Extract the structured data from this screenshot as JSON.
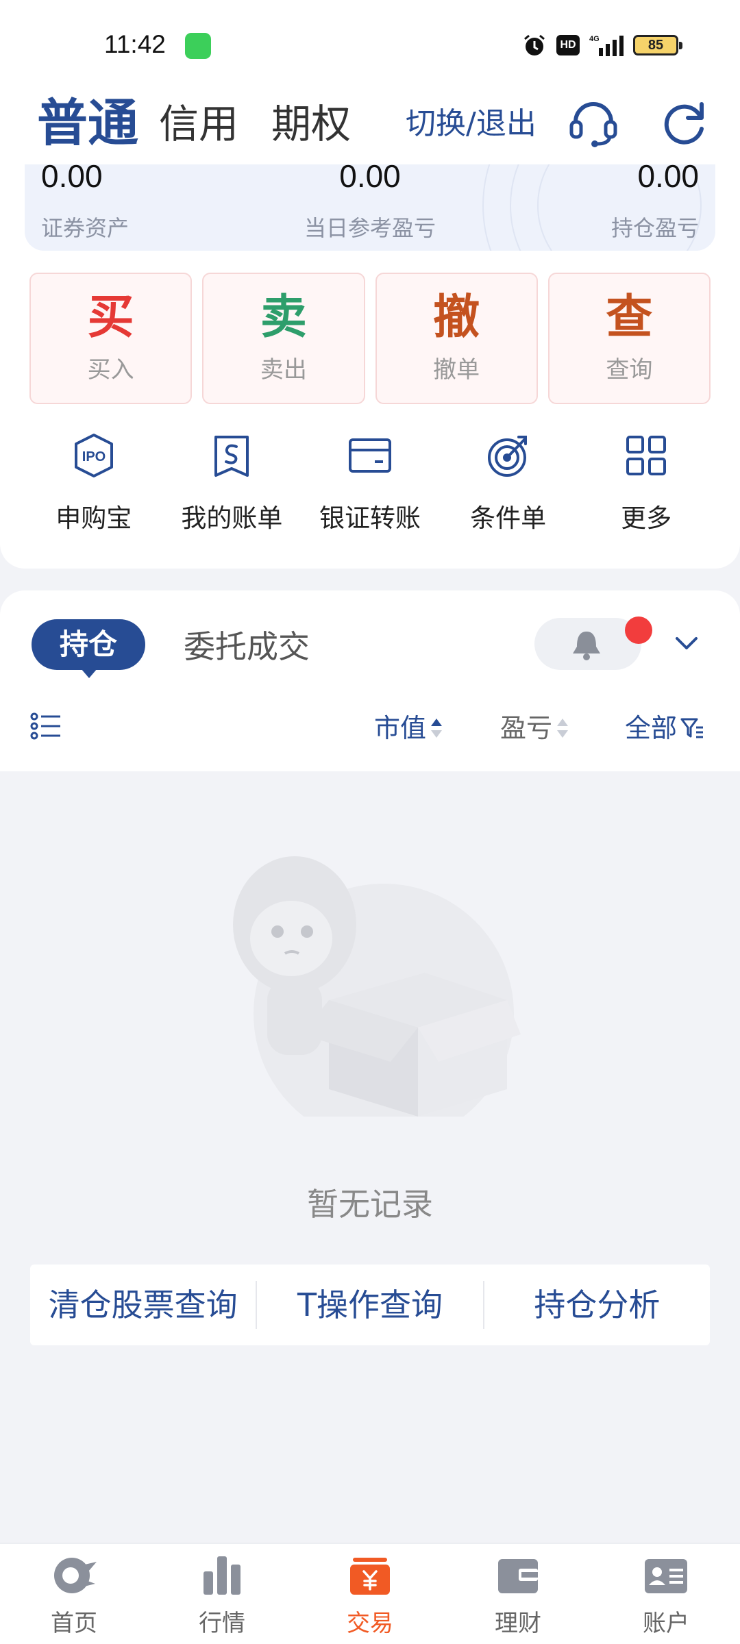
{
  "status_bar": {
    "time": "11:42",
    "battery": "85",
    "network": "4G",
    "hd": "HD"
  },
  "header": {
    "tabs": [
      "普通",
      "信用",
      "期权"
    ],
    "switch_exit": "切换/退出"
  },
  "assets": [
    {
      "value": "0.00",
      "label": "证券资产"
    },
    {
      "value": "0.00",
      "label": "当日参考盈亏"
    },
    {
      "value": "0.00",
      "label": "持仓盈亏"
    }
  ],
  "trade_buttons": [
    {
      "big": "买",
      "small": "买入",
      "color": "#e53935"
    },
    {
      "big": "卖",
      "small": "卖出",
      "color": "#2e9e6b"
    },
    {
      "big": "撤",
      "small": "撤单",
      "color": "#c4521f"
    },
    {
      "big": "查",
      "small": "查询",
      "color": "#c4521f"
    }
  ],
  "quick_actions": [
    {
      "label": "申购宝",
      "icon": "ipo-icon",
      "icon_text": "IPO"
    },
    {
      "label": "我的账单",
      "icon": "bill-icon"
    },
    {
      "label": "银证转账",
      "icon": "card-icon"
    },
    {
      "label": "条件单",
      "icon": "target-icon"
    },
    {
      "label": "更多",
      "icon": "grid-icon"
    }
  ],
  "positions": {
    "tab_active": "持仓",
    "tab_other": "委托成交",
    "sort_market_value": "市值",
    "sort_pnl": "盈亏",
    "filter_all": "全部",
    "empty_text": "暂无记录"
  },
  "query_links": [
    "清仓股票查询",
    "T操作查询",
    "持仓分析"
  ],
  "bottom_nav": [
    {
      "label": "首页",
      "icon": "home-icon"
    },
    {
      "label": "行情",
      "icon": "chart-icon"
    },
    {
      "label": "交易",
      "icon": "trade-icon",
      "active": true
    },
    {
      "label": "理财",
      "icon": "wallet-icon"
    },
    {
      "label": "账户",
      "icon": "account-icon"
    }
  ],
  "colors": {
    "primary": "#274c94",
    "accent": "#f15a24",
    "alert": "#f23d3d"
  }
}
